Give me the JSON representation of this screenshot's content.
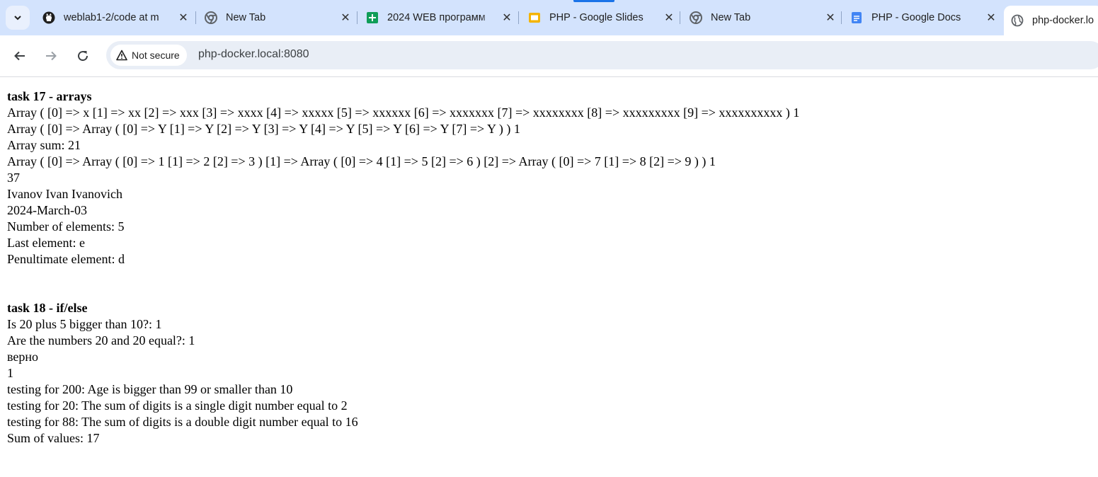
{
  "browser": {
    "tabs": [
      {
        "title": "weblab1-2/code at m",
        "icon": "github-icon"
      },
      {
        "title": "New Tab",
        "icon": "chrome-icon"
      },
      {
        "title": "2024 WEB программ",
        "icon": "sheets-icon"
      },
      {
        "title": "PHP - Google Slides",
        "icon": "slides-icon"
      },
      {
        "title": "New Tab",
        "icon": "chrome-icon"
      },
      {
        "title": "PHP - Google Docs",
        "icon": "docs-icon"
      },
      {
        "title": "php-docker.lo",
        "icon": "globe-icon"
      }
    ],
    "security_label": "Not secure",
    "url": "php-docker.local:8080",
    "colors": {
      "tabstrip": "#d3e3fd",
      "omnibox": "#e9eef6",
      "accent": "#1a73e8"
    }
  },
  "page": {
    "task17": {
      "heading": "task 17 - arrays",
      "lines": [
        "Array ( [0] => x [1] => xx [2] => xxx [3] => xxxx [4] => xxxxx [5] => xxxxxx [6] => xxxxxxx [7] => xxxxxxxx [8] => xxxxxxxxx [9] => xxxxxxxxxx ) 1",
        "Array ( [0] => Array ( [0] => Y [1] => Y [2] => Y [3] => Y [4] => Y [5] => Y [6] => Y [7] => Y ) ) 1",
        "Array sum: 21",
        "Array ( [0] => Array ( [0] => 1 [1] => 2 [2] => 3 ) [1] => Array ( [0] => 4 [1] => 5 [2] => 6 ) [2] => Array ( [0] => 7 [1] => 8 [2] => 9 ) ) 1",
        "37",
        "Ivanov Ivan Ivanovich",
        "2024-March-03",
        "Number of elements: 5",
        "Last element: e",
        "Penultimate element: d"
      ]
    },
    "task18": {
      "heading": "task 18 - if/else",
      "lines": [
        "Is 20 plus 5 bigger than 10?: 1",
        "Are the numbers 20 and 20 equal?: 1",
        "верно",
        "1",
        "testing for 200: Age is bigger than 99 or smaller than 10",
        "testing for 20: The sum of digits is a single digit number equal to 2",
        "testing for 88: The sum of digits is a double digit number equal to 16",
        "Sum of values: 17"
      ]
    }
  }
}
